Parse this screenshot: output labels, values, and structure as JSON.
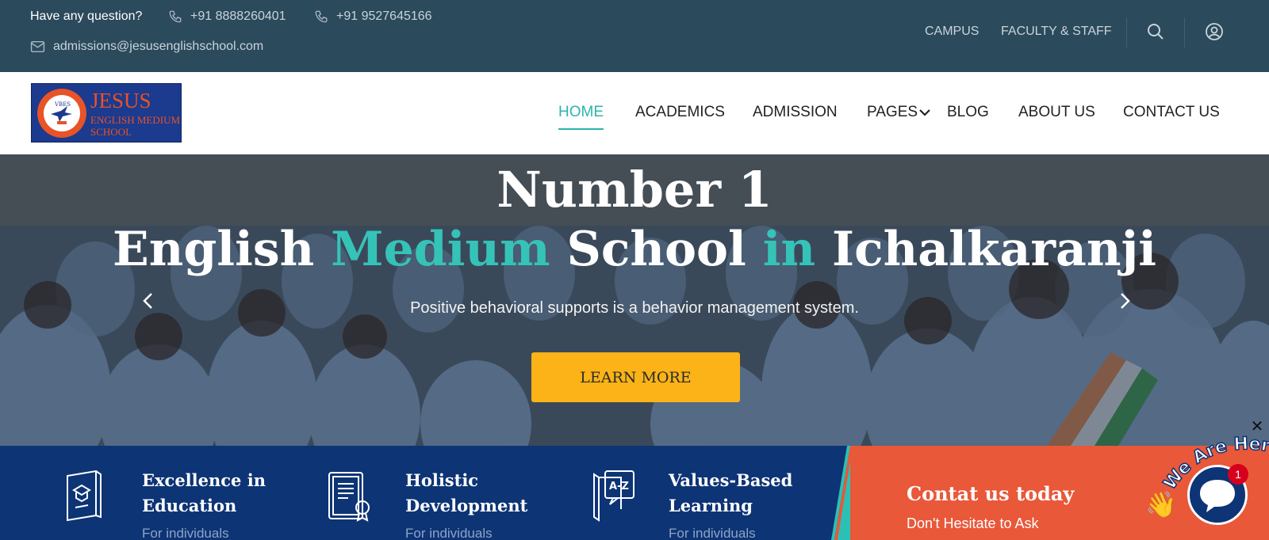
{
  "topbar": {
    "question": "Have any question?",
    "phone1": "+91 8888260401",
    "phone2": "+91 9527645166",
    "email": "admissions@jesusenglishschool.com",
    "links": [
      "CAMPUS",
      "FACULTY & STAFF"
    ],
    "icons": {
      "phone": "phone-icon",
      "email": "mail-icon",
      "search": "search-icon",
      "user": "user-circle-icon"
    }
  },
  "logo": {
    "name": "JESUS",
    "line1": "ENGLISH MEDIUM",
    "line2": "SCHOOL",
    "seal_text": "VBES"
  },
  "nav": {
    "items": [
      "HOME",
      "ACADEMICS",
      "ADMISSION",
      "PAGES",
      "BLOG",
      "ABOUT US",
      "CONTACT US"
    ],
    "active": "HOME"
  },
  "hero": {
    "line1": "Number 1",
    "line2_parts": [
      "English ",
      "Medium",
      " School ",
      "in",
      " Ichalkaranji"
    ],
    "tagline": "Positive behavioral supports is a behavior management system.",
    "cta": "LEARN MORE"
  },
  "features": [
    {
      "title_1": "Excellence in",
      "title_2": "Education",
      "subtitle": "For individuals",
      "icon": "certificate-book-icon"
    },
    {
      "title_1": "Holistic",
      "title_2": "Development",
      "subtitle": "For individuals",
      "icon": "diploma-icon"
    },
    {
      "title_1": "Values-Based",
      "title_2": "Learning",
      "subtitle": "For individuals",
      "icon": "a-z-book-icon"
    }
  ],
  "contact": {
    "title": "Contat us today",
    "subtitle": "Don't Hesitate to Ask"
  },
  "chat": {
    "banner": "We Are Here!",
    "badge": "1",
    "close": "✕"
  },
  "colors": {
    "topbar": "#2b4a5c",
    "accent": "#2bb5ad",
    "cta": "#fbb317",
    "band": "#0d3475",
    "contact": "#e95839"
  }
}
